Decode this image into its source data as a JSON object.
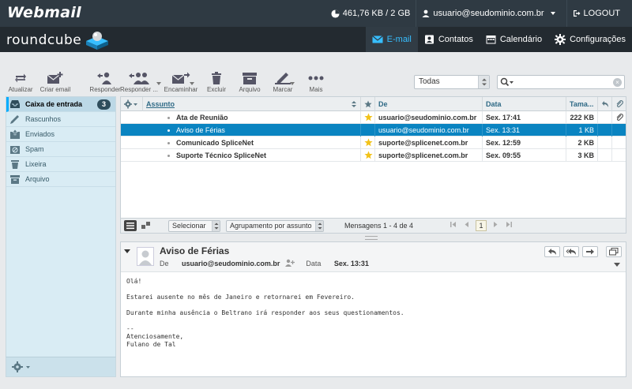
{
  "header": {
    "brand": "Webmail",
    "quota": "461,76 KB / 2 GB",
    "user": "usuario@seudominio.com.br",
    "logout": "LOGOUT"
  },
  "nav": {
    "logo": "roundcube",
    "tabs": [
      {
        "label": "E-mail",
        "icon": "envelope-icon",
        "active": true
      },
      {
        "label": "Contatos",
        "icon": "contacts-icon",
        "active": false
      },
      {
        "label": "Calendário",
        "icon": "calendar-icon",
        "active": false
      },
      {
        "label": "Configurações",
        "icon": "gear-icon",
        "active": false
      }
    ]
  },
  "toolbar": {
    "refresh": "Atualizar",
    "compose": "Criar email",
    "reply": "Responder",
    "reply_all": "Responder ...",
    "forward": "Encaminhar",
    "delete": "Excluir",
    "archive": "Arquivo",
    "mark": "Marcar",
    "more": "Mais",
    "filter_value": "Todas",
    "search_value": ""
  },
  "folders": [
    {
      "label": "Caixa de entrada",
      "icon": "inbox-icon",
      "count": "3",
      "selected": true
    },
    {
      "label": "Rascunhos",
      "icon": "pencil-icon",
      "count": "",
      "selected": false
    },
    {
      "label": "Enviados",
      "icon": "sent-icon",
      "count": "",
      "selected": false
    },
    {
      "label": "Spam",
      "icon": "spam-icon",
      "count": "",
      "selected": false
    },
    {
      "label": "Lixeira",
      "icon": "trash-icon",
      "count": "",
      "selected": false
    },
    {
      "label": "Arquivo",
      "icon": "archive-icon",
      "count": "",
      "selected": false
    }
  ],
  "message_list": {
    "columns": {
      "subject": "Assunto",
      "from": "De",
      "date": "Data",
      "size": "Tama..."
    },
    "rows": [
      {
        "subject": "Ata de Reunião",
        "from": "usuario@seudominio.com.br",
        "date": "Sex. 17:41",
        "size": "222 KB",
        "flagged": true,
        "attachment": true,
        "selected": false
      },
      {
        "subject": "Aviso de Férias",
        "from": "usuario@seudominio.com.br",
        "date": "Sex. 13:31",
        "size": "1 KB",
        "flagged": false,
        "attachment": false,
        "selected": true
      },
      {
        "subject": "Comunicado SpliceNet",
        "from": "suporte@splicenet.com.br",
        "date": "Sex. 12:59",
        "size": "2 KB",
        "flagged": true,
        "attachment": false,
        "selected": false
      },
      {
        "subject": "Suporte Técnico SpliceNet",
        "from": "suporte@splicenet.com.br",
        "date": "Sex. 09:55",
        "size": "3 KB",
        "flagged": true,
        "attachment": false,
        "selected": false
      }
    ],
    "footer": {
      "select": "Selecionar",
      "threading": "Agrupamento por assunto",
      "count": "Mensagens 1 - 4 de 4",
      "page": "1"
    }
  },
  "preview": {
    "subject": "Aviso de Férias",
    "from_label": "De",
    "from": "usuario@seudominio.com.br",
    "date_label": "Data",
    "date": "Sex. 13:31",
    "body": "Olá!\n\nEstarei ausente no mês de Janeiro e retornarei em Fevereiro.\n\nDurante minha ausência o Beltrano irá responder aos seus questionamentos.\n\n--\nAtenciosamente,\nFulano de Tal"
  },
  "colors": {
    "accent": "#37beff",
    "selected_row": "#0a84c1",
    "topbar": "#2f3a43",
    "navbar": "#232a30",
    "star": "#f2c219"
  }
}
